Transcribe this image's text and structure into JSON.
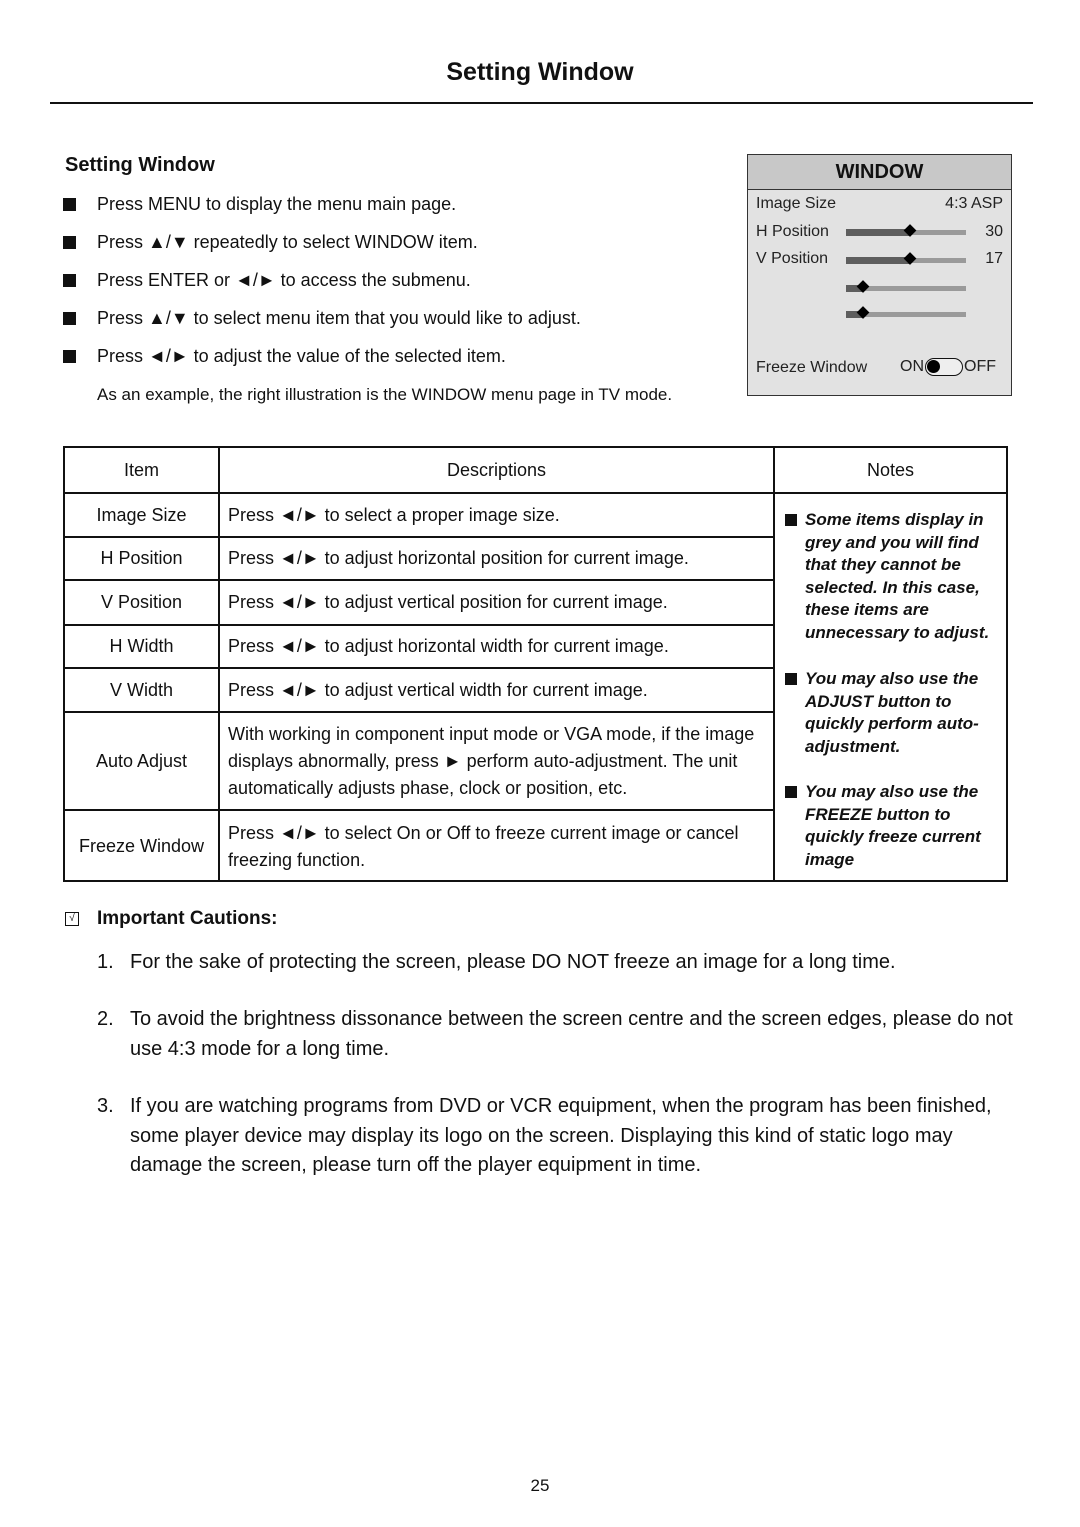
{
  "page": {
    "title": "Setting Window",
    "page_number": "25"
  },
  "section": {
    "title": "Setting Window",
    "steps": [
      "Press MENU to display the menu main page.",
      "Press ▲/▼ repeatedly to select WINDOW item.",
      "Press ENTER or ◄/► to access the submenu.",
      "Press ▲/▼ to select menu item that you would like to adjust.",
      "Press ◄/► to adjust the value of the selected item."
    ],
    "example_note": "As an example, the right illustration is the WINDOW menu page in TV mode."
  },
  "osd": {
    "header": "WINDOW",
    "rows": [
      {
        "label": "Image Size",
        "value": "4:3 ASP"
      },
      {
        "label": "H Position",
        "value": "30",
        "level": 0.53
      },
      {
        "label": "V Position",
        "value": "17",
        "level": 0.53
      },
      {
        "label": "",
        "value": "",
        "level": 0.14
      },
      {
        "label": "",
        "value": "",
        "level": 0.14
      }
    ],
    "freeze": {
      "label": "Freeze Window",
      "on_label": "ON",
      "off_label": "OFF",
      "state": "ON"
    }
  },
  "table": {
    "headers": [
      "Item",
      "Descriptions",
      "Notes"
    ],
    "rows": [
      {
        "item": "Image Size",
        "description": "Press ◄/► to select a proper image size."
      },
      {
        "item": "H Position",
        "description": "Press ◄/► to adjust horizontal position for current image."
      },
      {
        "item": "V Position",
        "description": "Press ◄/► to adjust vertical position for current image."
      },
      {
        "item": "H Width",
        "description": "Press ◄/► to adjust horizontal width for current image."
      },
      {
        "item": "V Width",
        "description": "Press ◄/► to adjust vertical width for current image."
      },
      {
        "item": "Auto Adjust",
        "description": "With working in component input mode or VGA mode, if the image displays abnormally, press ► perform auto-adjustment. The unit automatically adjusts phase, clock or position, etc."
      },
      {
        "item": "Freeze Window",
        "description": "Press ◄/► to select On or Off to freeze current image or cancel freezing function."
      }
    ],
    "notes": [
      "Some items display in grey and you will find that they cannot be selected. In this case, these items are unnecessary to adjust.",
      "You may also use the ADJUST button to quickly perform auto-adjustment.",
      "You may also use the FREEZE button to quickly freeze current image"
    ]
  },
  "cautions": {
    "title": "Important Cautions:",
    "check_glyph": "√",
    "items": [
      {
        "num": "1.",
        "text": "For the sake of protecting the screen, please DO NOT freeze an image for a long time."
      },
      {
        "num": "2.",
        "text": "To avoid the brightness dissonance between the screen centre and the screen edges, please do not use 4:3 mode for a long time."
      },
      {
        "num": "3.",
        "text": "If you are watching programs from DVD or VCR equipment, when the program has been finished, some player device may display its logo on the screen. Displaying this kind of static logo may damage the screen, please turn off the player equipment in time."
      }
    ]
  }
}
